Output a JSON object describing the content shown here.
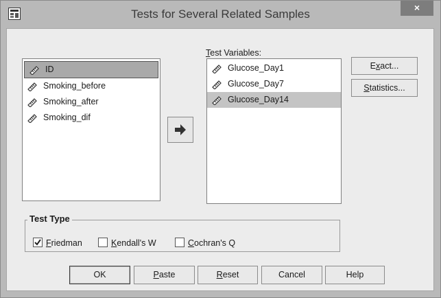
{
  "window": {
    "title": "Tests for Several Related Samples",
    "close_glyph": "×"
  },
  "source_list": {
    "items": [
      {
        "label": "ID",
        "selected": true
      },
      {
        "label": "Smoking_before",
        "selected": false
      },
      {
        "label": "Smoking_after",
        "selected": false
      },
      {
        "label": "Smoking_dif",
        "selected": false
      }
    ]
  },
  "test_variables": {
    "label_first": "T",
    "label_rest": "est Variables:",
    "items": [
      {
        "label": "Glucose_Day1",
        "selected": false
      },
      {
        "label": "Glucose_Day7",
        "selected": false
      },
      {
        "label": "Glucose_Day14",
        "selected": true
      }
    ]
  },
  "side_buttons": {
    "exact": {
      "pre": "E",
      "mnemonic": "x",
      "post": "act..."
    },
    "statistics": {
      "pre": "",
      "mnemonic": "S",
      "post": "tatistics..."
    }
  },
  "test_type": {
    "title": "Test Type",
    "options": [
      {
        "mnemonic": "F",
        "rest": "riedman",
        "checked": true
      },
      {
        "mnemonic": "K",
        "rest": "endall's W",
        "checked": false
      },
      {
        "mnemonic": "C",
        "rest": "ochran's Q",
        "checked": false
      }
    ]
  },
  "footer_buttons": {
    "ok": "OK",
    "paste": {
      "mnemonic": "P",
      "rest": "aste"
    },
    "reset": {
      "mnemonic": "R",
      "rest": "eset"
    },
    "cancel": "Cancel",
    "help": "Help"
  },
  "colors": {
    "titlebar": "#b9b9b9",
    "client": "#ececec",
    "selection": "#c4c4c4",
    "close": "#7d7d7d"
  }
}
